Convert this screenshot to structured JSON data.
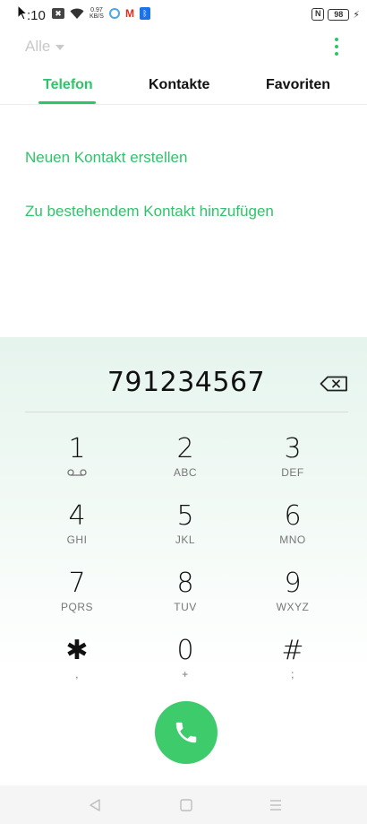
{
  "status_bar": {
    "time": ":10",
    "net_speed_value": "0.97",
    "net_speed_unit": "KB/S",
    "battery": "98",
    "icons": [
      "notification-box-icon",
      "wifi-icon",
      "circle-app-icon",
      "gmail-icon",
      "bluetooth-app-icon",
      "nfc-icon",
      "battery-icon",
      "charging-icon"
    ]
  },
  "header": {
    "filter_label": "Alle"
  },
  "tabs": [
    {
      "label": "Telefon",
      "active": true
    },
    {
      "label": "Kontakte",
      "active": false
    },
    {
      "label": "Favoriten",
      "active": false
    }
  ],
  "actions": {
    "new_contact": "Neuen Kontakt erstellen",
    "add_to_existing": "Zu bestehendem Kontakt hinzufügen"
  },
  "dialer": {
    "number": "791234567",
    "keys": [
      {
        "digit": "1",
        "sub": ""
      },
      {
        "digit": "2",
        "sub": "ABC"
      },
      {
        "digit": "3",
        "sub": "DEF"
      },
      {
        "digit": "4",
        "sub": "GHI"
      },
      {
        "digit": "5",
        "sub": "JKL"
      },
      {
        "digit": "6",
        "sub": "MNO"
      },
      {
        "digit": "7",
        "sub": "PQRS"
      },
      {
        "digit": "8",
        "sub": "TUV"
      },
      {
        "digit": "9",
        "sub": "WXYZ"
      },
      {
        "digit": "✱",
        "sub": ","
      },
      {
        "digit": "0",
        "sub": "+"
      },
      {
        "digit": "#",
        "sub": ";"
      }
    ]
  },
  "colors": {
    "accent": "#2fc46a",
    "call_button": "#3dcb6c",
    "panel_top": "#e6f4ee"
  }
}
